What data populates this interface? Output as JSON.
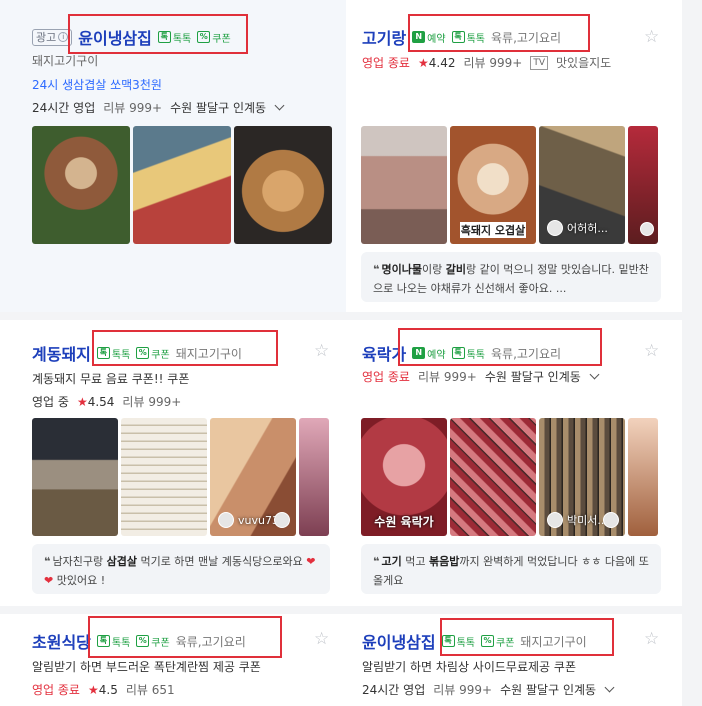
{
  "cards": [
    {
      "id": "c1",
      "ad_label": "광고",
      "name": "윤이냉삼집",
      "tags": [
        {
          "icon": "talk",
          "label": "톡톡"
        },
        {
          "icon": "coupon",
          "label": "쿠폰"
        }
      ],
      "category": "돼지고기구이",
      "promo": "24시 생삼겹살 쏘맥3천원",
      "hours": "24시간 영업",
      "reviews": "리뷰 999+",
      "location": "수원 팔달구 인계동",
      "photos": [
        {
          "colors": [
            "#3e5d2e",
            "#8f5a3b",
            "#d4b48f"
          ],
          "caption": ""
        },
        {
          "colors": [
            "#5b7a8c",
            "#b8423c",
            "#e8c87a"
          ],
          "caption": ""
        },
        {
          "colors": [
            "#2b2725",
            "#b07a44",
            "#d9a56b"
          ],
          "caption": ""
        }
      ]
    },
    {
      "id": "c2",
      "name": "고기랑",
      "tags": [
        {
          "icon": "naver",
          "label": "예약"
        },
        {
          "icon": "talk",
          "label": "톡톡"
        }
      ],
      "category": "육류,고기요리",
      "status": "영업 종료",
      "rating": "4.42",
      "reviews": "리뷰 999+",
      "tv": "TV",
      "tv_text": "맛있을지도",
      "photos": [
        {
          "colors": [
            "#cfc5c0",
            "#b98f84",
            "#7a5d55"
          ],
          "caption": "",
          "label": ""
        },
        {
          "colors": [
            "#d8a984",
            "#a2542d",
            "#f1dfc8"
          ],
          "caption": "흑돼지 오겹살"
        },
        {
          "colors": [
            "#6e5f48",
            "#3a3a3a",
            "#bfa57d"
          ],
          "caption": "",
          "user": "어허허..."
        },
        {
          "colors": [
            "#b52a3b",
            "#5c1d1f",
            "#ed8a7a"
          ],
          "caption": ""
        }
      ],
      "review": {
        "bold1": "명이나물",
        "t1": "이랑 ",
        "bold2": "갈비",
        "t2": "랑 같이 먹으니 정말 맛있습니다. 밑반찬으로 나오는 야채류가 신선해서 좋아요. ..."
      }
    },
    {
      "id": "c3",
      "name": "계동돼지",
      "tags": [
        {
          "icon": "talk",
          "label": "톡톡"
        },
        {
          "icon": "coupon",
          "label": "쿠폰"
        }
      ],
      "category": "돼지고기구이",
      "promo": "계동돼지 무료 음료 쿠폰!! 쿠폰",
      "status": "영업 중",
      "rating": "4.54",
      "reviews": "리뷰 999+",
      "photos": [
        {
          "colors": [
            "#2a2e36",
            "#6a5a44",
            "#9b8f80"
          ],
          "caption": ""
        },
        {
          "colors": [
            "#f2ede4",
            "#c9bfa9",
            "#7c6f5c"
          ],
          "caption": ""
        },
        {
          "colors": [
            "#c98f6a",
            "#e9c6a0",
            "#8a4d34"
          ],
          "caption": "",
          "user": "vuvu73"
        },
        {
          "colors": [
            "#c2708c",
            "#e0a8b8",
            "#7d3f52"
          ],
          "caption": ""
        }
      ],
      "review": {
        "t0": "남자친구랑 ",
        "bold1": "삼겹살",
        "t1": " 먹기로 하면 맨날 계동식당으로와요 ",
        "hearts": "❤❤",
        "t2": " 맛있어요 !"
      }
    },
    {
      "id": "c4",
      "name": "육락가",
      "tags": [
        {
          "icon": "naver",
          "label": "예약"
        },
        {
          "icon": "talk",
          "label": "톡톡"
        }
      ],
      "category": "육류,고기요리",
      "status": "영업 종료",
      "reviews": "리뷰 999+",
      "location": "수원 팔달구 인계동",
      "photos": [
        {
          "colors": [
            "#b23a44",
            "#7e1d26",
            "#e7a2a4"
          ],
          "caption": "수원 육락가"
        },
        {
          "colors": [
            "#9c2a36",
            "#4a2a2a",
            "#d67a80"
          ],
          "caption": ""
        },
        {
          "colors": [
            "#5b4c3e",
            "#2a241f",
            "#a88d6b"
          ],
          "caption": "",
          "user": "박미서..."
        },
        {
          "colors": [
            "#d69a80",
            "#a0603d",
            "#f2d2bd"
          ],
          "caption": ""
        }
      ],
      "review": {
        "bold1": "고기",
        "t1": " 먹고 ",
        "bold2": "볶음밥",
        "t2": "까지 완벽하게 먹었답니다 ㅎㅎ 다음에 또 올게요"
      }
    },
    {
      "id": "c5",
      "name": "초원식당",
      "tags": [
        {
          "icon": "talk",
          "label": "톡톡"
        },
        {
          "icon": "coupon",
          "label": "쿠폰"
        }
      ],
      "category": "육류,고기요리",
      "promo": "알림받기 하면 부드러운 폭탄계란찜 제공 쿠폰",
      "status": "영업 종료",
      "rating": "4.5",
      "reviews": "리뷰 651"
    },
    {
      "id": "c6",
      "name": "윤이냉삼집",
      "tags": [
        {
          "icon": "talk",
          "label": "톡톡"
        },
        {
          "icon": "coupon",
          "label": "쿠폰"
        }
      ],
      "category": "돼지고기구이",
      "promo": "알림받기 하면 차림상 사이드무료제공 쿠폰",
      "hours": "24시간 영업",
      "reviews": "리뷰 999+",
      "location": "수원 팔달구 인계동"
    }
  ],
  "icons": {
    "talk": "톡",
    "coupon": "%",
    "naver": "N",
    "star_filled": "★",
    "star_empty": "☆",
    "quote": "❝"
  },
  "colors": {
    "name_blue": "#1d3fbb",
    "tag_green": "#1fa043",
    "status_red": "#e3303e",
    "highlight_red": "#e0303a"
  }
}
